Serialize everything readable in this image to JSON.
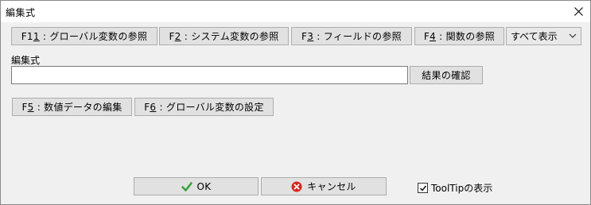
{
  "window": {
    "title": "編集式"
  },
  "toolbar": {
    "buttons": [
      {
        "key": "F11",
        "label": "グローバル変数の参照"
      },
      {
        "key": "F2",
        "label": "システム変数の参照"
      },
      {
        "key": "F3",
        "label": "フィールドの参照"
      },
      {
        "key": "F4",
        "label": "関数の参照"
      }
    ],
    "filter_select": {
      "value": "すべて表示"
    }
  },
  "expression": {
    "label": "編集式",
    "value": "",
    "check_result_label": "結果の確認"
  },
  "actions": [
    {
      "key": "F5",
      "label": "数値データの編集"
    },
    {
      "key": "F6",
      "label": "グローバル変数の設定"
    }
  ],
  "footer": {
    "ok_label": "OK",
    "cancel_label": "キャンセル",
    "tooltip_checkbox": {
      "label": "ToolTipの表示",
      "checked": true
    }
  },
  "icons": {
    "ok": "checkmark-icon",
    "cancel": "cancel-icon",
    "close": "close-icon"
  },
  "colors": {
    "ok_icon": "#3aa13a",
    "cancel_icon": "#d9251c"
  }
}
